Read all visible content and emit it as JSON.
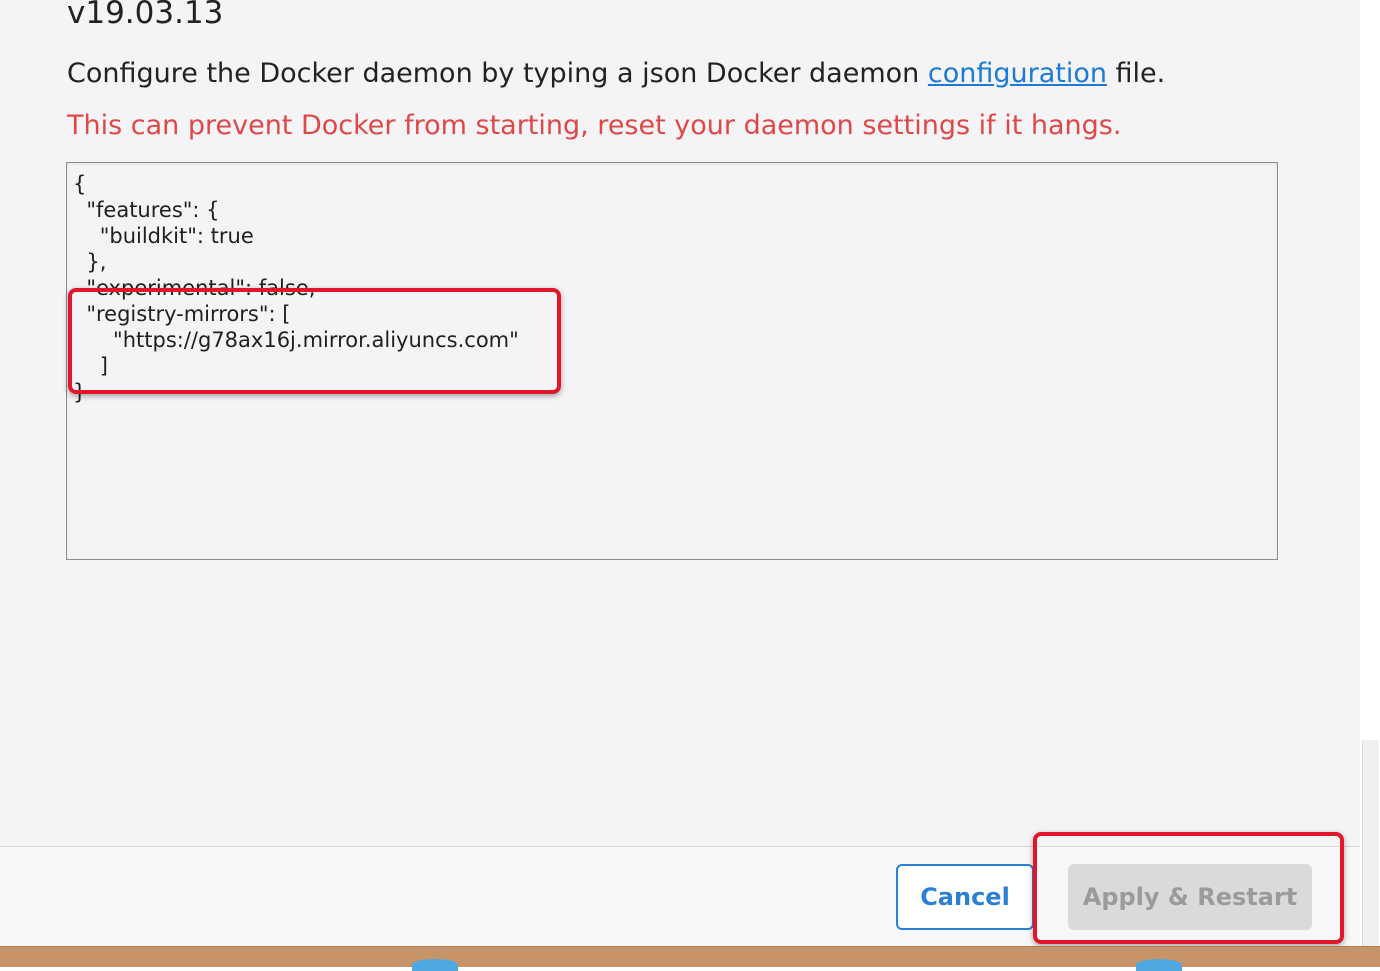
{
  "header": {
    "version": "v19.03.13"
  },
  "description": {
    "before_link": "Configure the Docker daemon by typing a json Docker daemon ",
    "link_text": "configuration",
    "after_link": " file."
  },
  "warning": "This can prevent Docker from starting, reset your daemon settings if it hangs.",
  "editor": {
    "content": "{\n  \"features\": {\n    \"buildkit\": true\n  },\n  \"experimental\": false,\n  \"registry-mirrors\": [\n      \"https://g78ax16j.mirror.aliyuncs.com\"\n    ]\n}"
  },
  "footer": {
    "cancel_label": "Cancel",
    "apply_label": "Apply & Restart",
    "apply_disabled": true
  },
  "colors": {
    "warning": "#e04848",
    "link": "#1f7ad6",
    "primary": "#2b7fd4",
    "annotation": "#e0162b"
  }
}
